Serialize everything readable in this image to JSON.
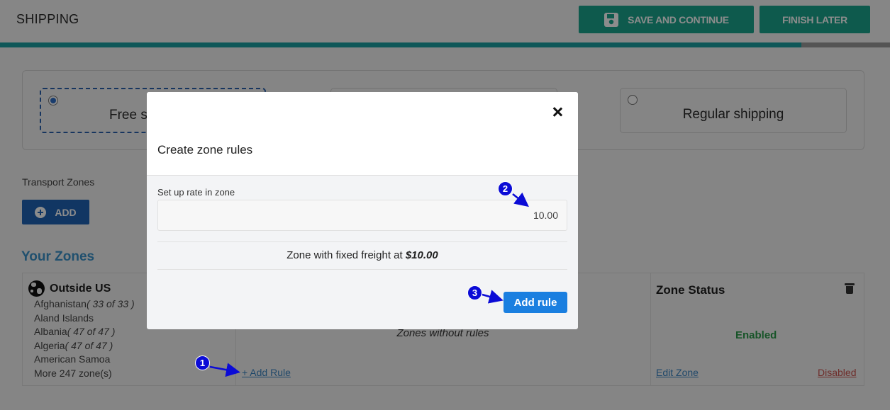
{
  "header": {
    "title": "SHIPPING",
    "save_label": "SAVE AND CONTINUE",
    "finish_label": "FINISH LATER",
    "progress_percent": 90
  },
  "shipping_options": {
    "free_label": "Free s",
    "regular_label": "Regular shipping"
  },
  "zones": {
    "section_label": "Transport Zones",
    "add_label": "ADD",
    "heading": "Your Zones",
    "zone_name": "Outside US",
    "countries": [
      {
        "name": "Afghanistan",
        "count": "( 33 of 33 )"
      },
      {
        "name": "Aland Islands",
        "count": ""
      },
      {
        "name": "Albania",
        "count": "( 47 of 47 )"
      },
      {
        "name": "Algeria",
        "count": "( 47 of 47 )"
      },
      {
        "name": "American Samoa",
        "count": ""
      },
      {
        "name": "More 247 zone(s)",
        "count": ""
      }
    ],
    "add_rule_link": "+ Add Rule",
    "zones_without_rules": "Zones without rules",
    "status_title": "Zone Status",
    "status_value": "Enabled",
    "edit_zone": "Edit Zone",
    "disabled_link": "Disabled"
  },
  "modal": {
    "title": "Create zone rules",
    "rate_label": "Set up rate in zone",
    "rate_value": "10.00",
    "freight_prefix": "Zone with fixed freight at ",
    "freight_amount": "$10.00",
    "add_rule_button": "Add rule"
  },
  "annotations": {
    "marker1": "1",
    "marker2": "2",
    "marker3": "3",
    "color": "#0b0bd6"
  }
}
